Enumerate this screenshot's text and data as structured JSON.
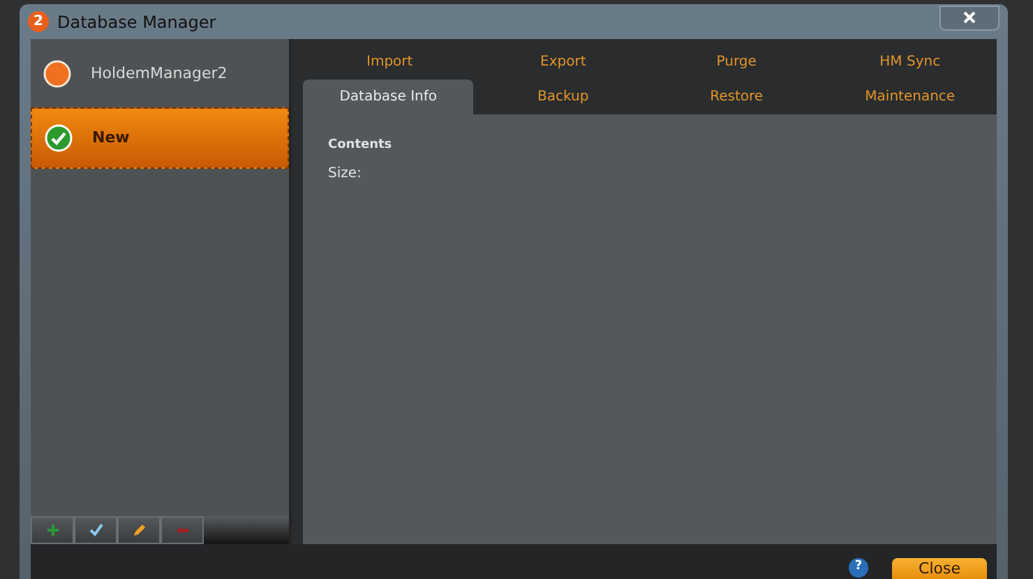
{
  "window": {
    "logo": "2",
    "title": "Database Manager"
  },
  "sidebar": {
    "items": [
      {
        "label": "HoldemManager2",
        "selected": false,
        "active": false
      },
      {
        "label": "New",
        "selected": true,
        "active": true
      }
    ]
  },
  "toolbar": [
    {
      "kind": "add"
    },
    {
      "kind": "check"
    },
    {
      "kind": "edit"
    },
    {
      "kind": "remove"
    }
  ],
  "tabs": [
    [
      {
        "label": "Import",
        "selected": false
      },
      {
        "label": "Export",
        "selected": false
      },
      {
        "label": "Purge",
        "selected": false
      },
      {
        "label": "HM Sync",
        "selected": false
      }
    ],
    [
      {
        "label": "Database Info",
        "selected": true
      },
      {
        "label": "Backup",
        "selected": false
      },
      {
        "label": "Restore",
        "selected": false
      },
      {
        "label": "Maintenance",
        "selected": false
      }
    ]
  ],
  "content": {
    "heading": "Contents",
    "fields": [
      "Size:"
    ]
  },
  "footer": {
    "help": "?",
    "close": "Close"
  }
}
